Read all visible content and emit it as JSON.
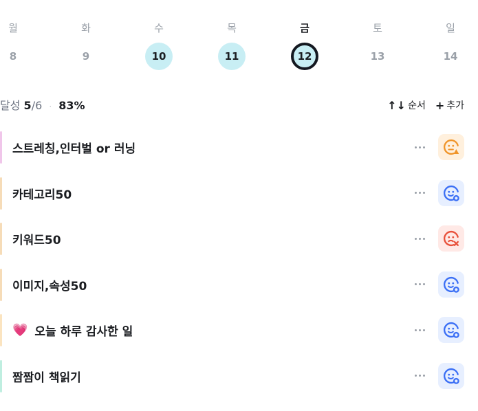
{
  "week": [
    {
      "dow": "월",
      "date": "8",
      "state": "none"
    },
    {
      "dow": "화",
      "date": "9",
      "state": "none"
    },
    {
      "dow": "수",
      "date": "10",
      "state": "done"
    },
    {
      "dow": "목",
      "date": "11",
      "state": "done"
    },
    {
      "dow": "금",
      "date": "12",
      "state": "today"
    },
    {
      "dow": "토",
      "date": "13",
      "state": "none"
    },
    {
      "dow": "일",
      "date": "14",
      "state": "none"
    }
  ],
  "summary": {
    "label": "달성",
    "done": "5",
    "total": "/6",
    "sep": "·",
    "percent": "83%"
  },
  "actions": {
    "order_icon": "↑↓",
    "order_label": "순서",
    "add_icon": "+",
    "add_label": "추가"
  },
  "habits": [
    {
      "title": "스트레칭,인터벌 or 러닝",
      "bar_color": "#f0c6ea",
      "status": "warning",
      "emoji": ""
    },
    {
      "title": "카테고리50",
      "bar_color": "#f6dcb8",
      "status": "done",
      "emoji": ""
    },
    {
      "title": "키워드50",
      "bar_color": "#f6dcb8",
      "status": "failed",
      "emoji": ""
    },
    {
      "title": "이미지,속성50",
      "bar_color": "#f6dcb8",
      "status": "done",
      "emoji": ""
    },
    {
      "title": "오늘 하루 감사한 일",
      "bar_color": "#fbe4c0",
      "status": "done",
      "emoji": "💗"
    },
    {
      "title": "짬짬이 책읽기",
      "bar_color": "#bfeee0",
      "status": "done",
      "emoji": ""
    }
  ],
  "status_colors": {
    "done": {
      "bg": "#e7efff",
      "fg": "#3b6ff5"
    },
    "warning": {
      "bg": "#fff0dd",
      "fg": "#f0952a"
    },
    "failed": {
      "bg": "#ffe9e6",
      "fg": "#e8503a"
    }
  }
}
